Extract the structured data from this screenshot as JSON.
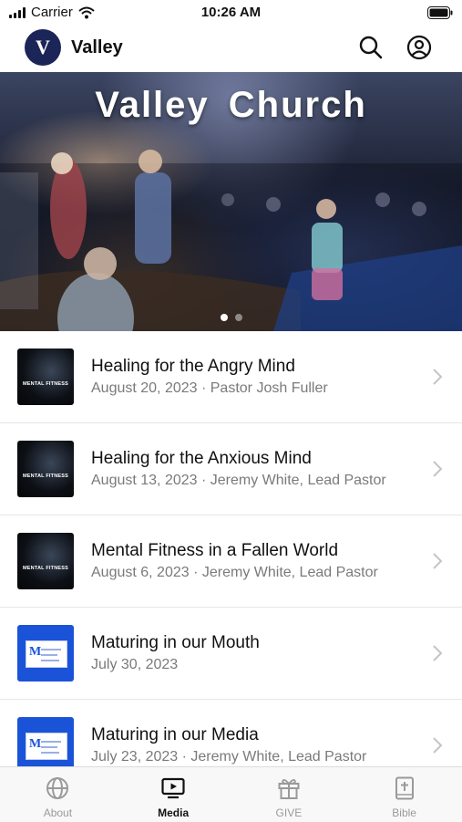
{
  "status_bar": {
    "carrier": "Carrier",
    "time": "10:26 AM"
  },
  "header": {
    "logo_letter": "V",
    "brand": "Valley"
  },
  "hero": {
    "title": "Valley Church",
    "slide_count": 2,
    "active_slide": 1
  },
  "sermons": [
    {
      "title": "Healing for the Angry Mind",
      "subtitle": "August 20, 2023 · Pastor Josh Fuller",
      "thumb_style": "dark",
      "thumb_text": "MENTAL FITNESS"
    },
    {
      "title": "Healing for the Anxious Mind",
      "subtitle": "August 13, 2023 · Jeremy White, Lead Pastor",
      "thumb_style": "dark",
      "thumb_text": "MENTAL FITNESS"
    },
    {
      "title": "Mental Fitness in a Fallen World",
      "subtitle": "August 6, 2023 · Jeremy White, Lead Pastor",
      "thumb_style": "dark",
      "thumb_text": "MENTAL FITNESS"
    },
    {
      "title": "Maturing in our Mouth",
      "subtitle": "July 30, 2023",
      "thumb_style": "blue",
      "thumb_text": "M"
    },
    {
      "title": "Maturing in our Media",
      "subtitle": "July 23, 2023 · Jeremy White, Lead Pastor",
      "thumb_style": "blue",
      "thumb_text": "M"
    }
  ],
  "tabs": [
    {
      "label": "About",
      "icon": "globe-icon",
      "active": false
    },
    {
      "label": "Media",
      "icon": "tv-play-icon",
      "active": true
    },
    {
      "label": "GIVE",
      "icon": "gift-icon",
      "active": false
    },
    {
      "label": "Bible",
      "icon": "bible-icon",
      "active": false
    }
  ],
  "colors": {
    "logo_bg": "#1c2558",
    "accent_blue": "#1a53d8",
    "inactive_tab": "#9a9a9a"
  }
}
